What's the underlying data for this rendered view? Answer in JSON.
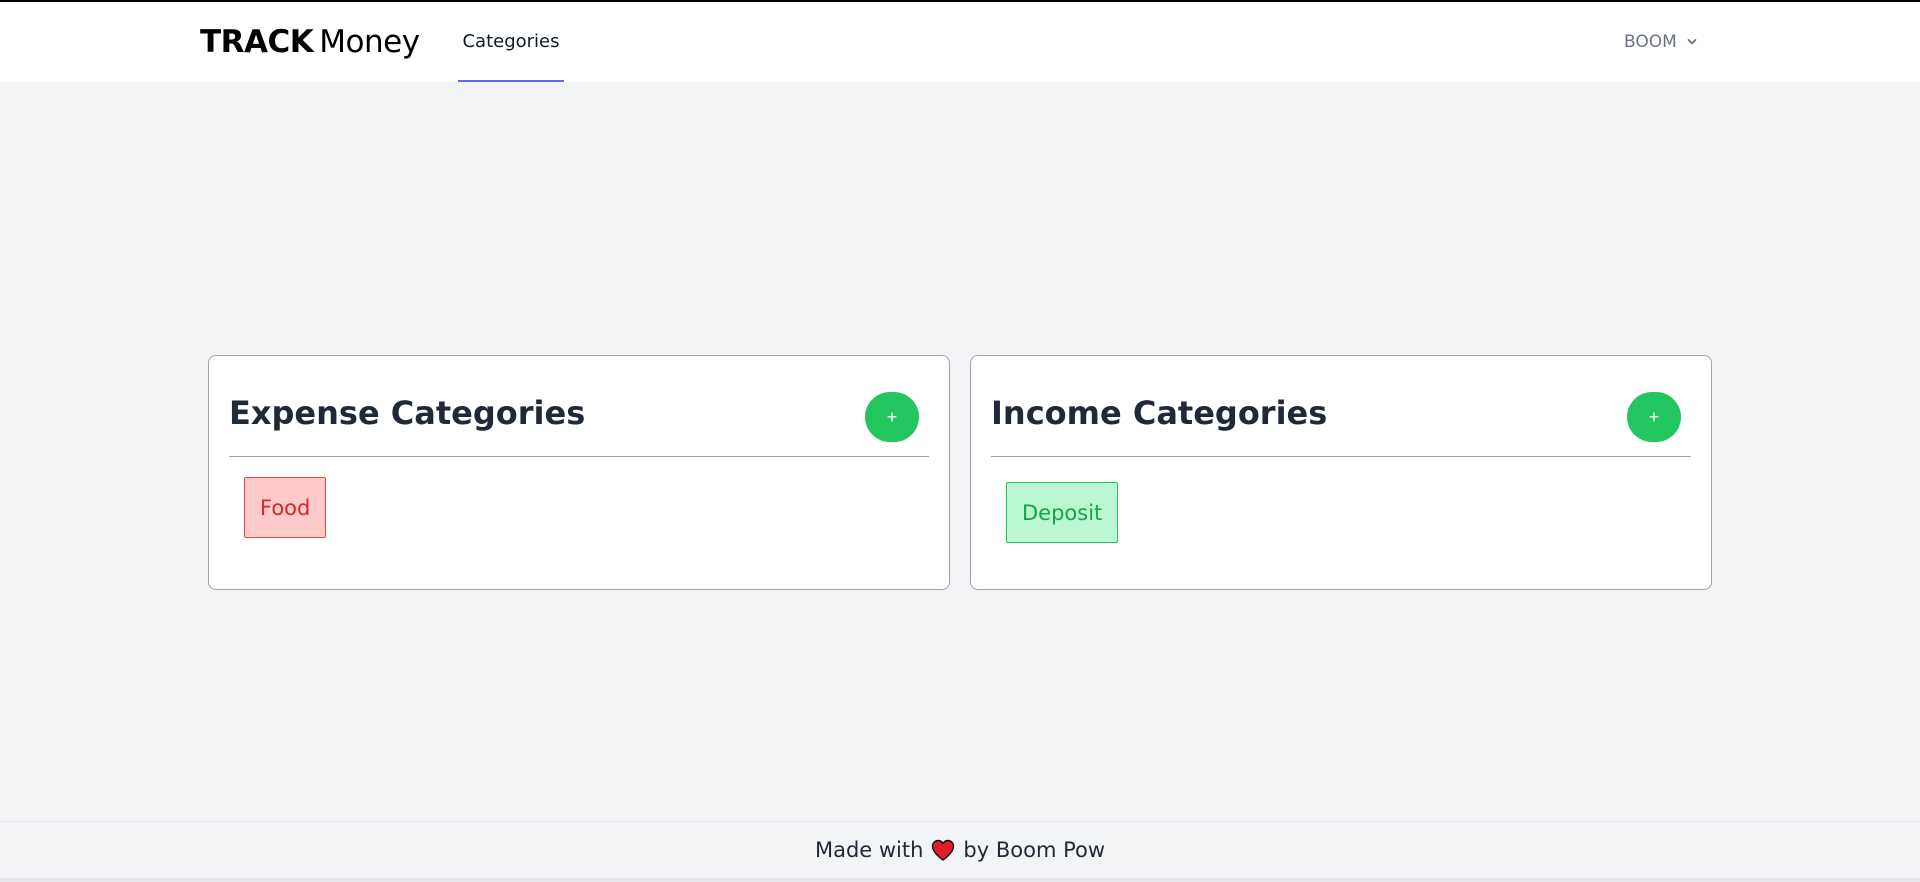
{
  "brand": {
    "bold": "TRACK",
    "light": "Money"
  },
  "nav": {
    "active_link": "Categories"
  },
  "user": {
    "name": "BOOM"
  },
  "expense": {
    "title": "Expense Categories",
    "add_label": "+",
    "items": [
      {
        "label": "Food"
      }
    ]
  },
  "income": {
    "title": "Income Categories",
    "add_label": "+",
    "items": [
      {
        "label": "Deposit"
      }
    ]
  },
  "footer": {
    "prefix": "Made with",
    "suffix": "by Boom Pow"
  },
  "colors": {
    "accent": "#6366f1",
    "success": "#22c55e",
    "danger": "#dc2626",
    "background": "#f3f4f6"
  }
}
